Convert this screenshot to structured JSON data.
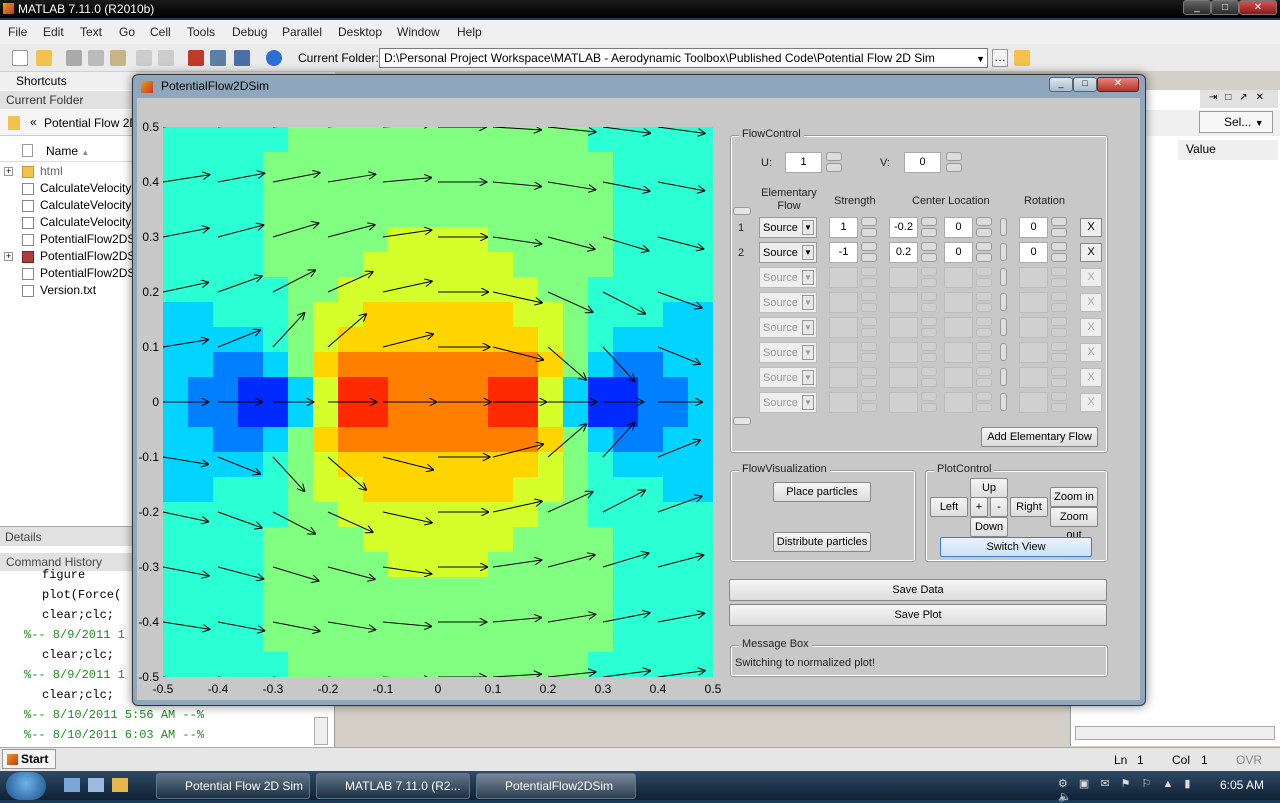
{
  "matlab": {
    "title": "MATLAB  7.11.0 (R2010b)",
    "menu": [
      "File",
      "Edit",
      "Text",
      "Go",
      "Cell",
      "Tools",
      "Debug",
      "Parallel",
      "Desktop",
      "Window",
      "Help"
    ],
    "current_folder_label": "Current Folder:",
    "current_folder_path": "D:\\Personal Project Workspace\\MATLAB - Aerodynamic Toolbox\\Published Code\\Potential Flow 2D Sim",
    "shortcuts": "Shortcuts",
    "current_folder_panel": "Current Folder",
    "breadcrumb": "Potential Flow 2D",
    "name_col": "Name",
    "files": [
      "html",
      "CalculateVelocity",
      "CalculateVelocity",
      "CalculateVelocity",
      "PotentialFlow2DS",
      "PotentialFlow2DS",
      "PotentialFlow2DS",
      "Version.txt"
    ],
    "details": "Details",
    "command_history": "Command History",
    "history": [
      "figure",
      "plot(Force(",
      "clear;clc;",
      "%-- 8/9/2011 1",
      "clear;clc;",
      "%-- 8/9/2011 1",
      "clear;clc;",
      "%-- 8/10/2011 5:56 AM --%",
      "%-- 8/10/2011 6:03 AM --%"
    ],
    "workspace_value_col": "Value",
    "workspace_select": "Sel...",
    "status_ln_label": "Ln",
    "status_ln": "1",
    "status_col_label": "Col",
    "status_col": "1",
    "status_ovr": "OVR",
    "start": "Start"
  },
  "taskbar": {
    "items": [
      "Potential Flow 2D Sim",
      "MATLAB  7.11.0 (R2...",
      "PotentialFlow2DSim"
    ],
    "clock": "6:05 AM"
  },
  "pf": {
    "title": "PotentialFlow2DSim",
    "flow_control": "FlowControl",
    "u_label": "U:",
    "u_value": "1",
    "v_label": "V:",
    "v_value": "0",
    "col_elementary": "Elementary\nFlow",
    "col_strength": "Strength",
    "col_center": "Center Location",
    "col_rotation": "Rotation",
    "rows": [
      {
        "idx": "1",
        "type": "Source",
        "strength": "1",
        "cx": "-0.2",
        "cy": "0",
        "rot": "0",
        "enabled": true
      },
      {
        "idx": "2",
        "type": "Source",
        "strength": "-1",
        "cx": "0.2",
        "cy": "0",
        "rot": "0",
        "enabled": true
      },
      {
        "idx": "",
        "type": "Source",
        "strength": "",
        "cx": "",
        "cy": "",
        "rot": "",
        "enabled": false
      },
      {
        "idx": "",
        "type": "Source",
        "strength": "",
        "cx": "",
        "cy": "",
        "rot": "",
        "enabled": false
      },
      {
        "idx": "",
        "type": "Source",
        "strength": "",
        "cx": "",
        "cy": "",
        "rot": "",
        "enabled": false
      },
      {
        "idx": "",
        "type": "Source",
        "strength": "",
        "cx": "",
        "cy": "",
        "rot": "",
        "enabled": false
      },
      {
        "idx": "",
        "type": "Source",
        "strength": "",
        "cx": "",
        "cy": "",
        "rot": "",
        "enabled": false
      },
      {
        "idx": "",
        "type": "Source",
        "strength": "",
        "cx": "",
        "cy": "",
        "rot": "",
        "enabled": false
      }
    ],
    "remove_label": "X",
    "add_flow": "Add Elementary Flow",
    "flow_vis": "FlowVisualization",
    "place_particles": "Place particles",
    "distribute_particles": "Distribute particles",
    "plot_control": "PlotControl",
    "up": "Up",
    "down": "Down",
    "left": "Left",
    "right": "Right",
    "plus": "+",
    "minus": "-",
    "zoom_in": "Zoom in",
    "zoom_out": "Zoom out",
    "switch_view": "Switch View",
    "save_data": "Save Data",
    "save_plot": "Save Plot",
    "message_box": "Message Box",
    "message": "Switching to normalized plot!"
  },
  "chart_data": {
    "type": "heatmap",
    "title": "",
    "xlim": [
      -0.5,
      0.5
    ],
    "ylim": [
      -0.5,
      0.5
    ],
    "xticks": [
      "-0.5",
      "-0.4",
      "-0.3",
      "-0.2",
      "-0.1",
      "0",
      "0.1",
      "0.2",
      "0.3",
      "0.4",
      "0.5"
    ],
    "yticks": [
      "0.5",
      "0.4",
      "0.3",
      "0.2",
      "0.1",
      "0",
      "-0.1",
      "-0.2",
      "-0.3",
      "-0.4",
      "-0.5"
    ],
    "field": "velocity magnitude contour with quiver arrows",
    "sources": [
      {
        "x": -0.2,
        "y": 0,
        "strength": 1
      },
      {
        "x": 0.2,
        "y": 0,
        "strength": -1
      }
    ],
    "freestream": {
      "U": 1,
      "V": 0
    },
    "colormap": "jet"
  }
}
